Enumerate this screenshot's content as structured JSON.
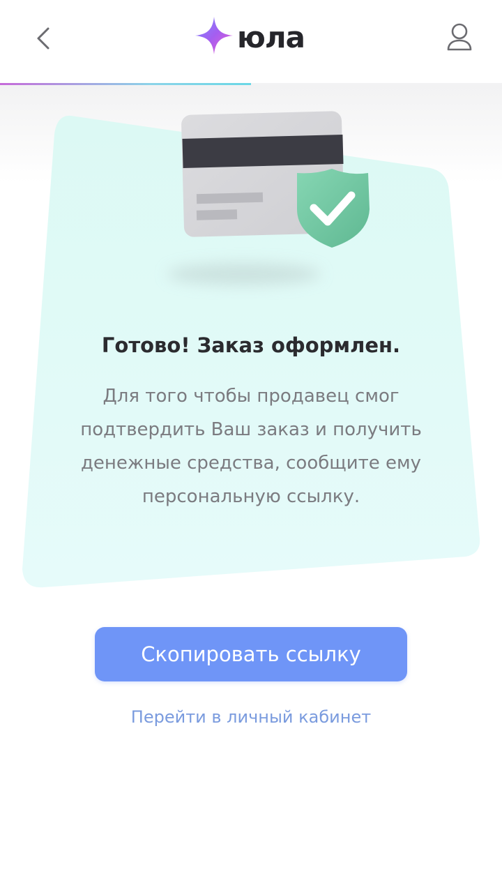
{
  "header": {
    "logo_text": "юла",
    "progress": 0.5
  },
  "main": {
    "title": "Готово! Заказ оформлен.",
    "description_lines": [
      "Для того чтобы продавец смог",
      "подтвердить Ваш заказ и получить",
      "денежные средства, сообщите ему",
      "персональную ссылку."
    ]
  },
  "actions": {
    "copy_link_label": "Скопировать ссылку",
    "cabinet_link_label": "Перейти в личный кабинет"
  },
  "colors": {
    "primary_button": "#6f95f7",
    "link": "#7a9bde",
    "card_background": "#e3fbf8",
    "shield": "#73c9a4"
  }
}
